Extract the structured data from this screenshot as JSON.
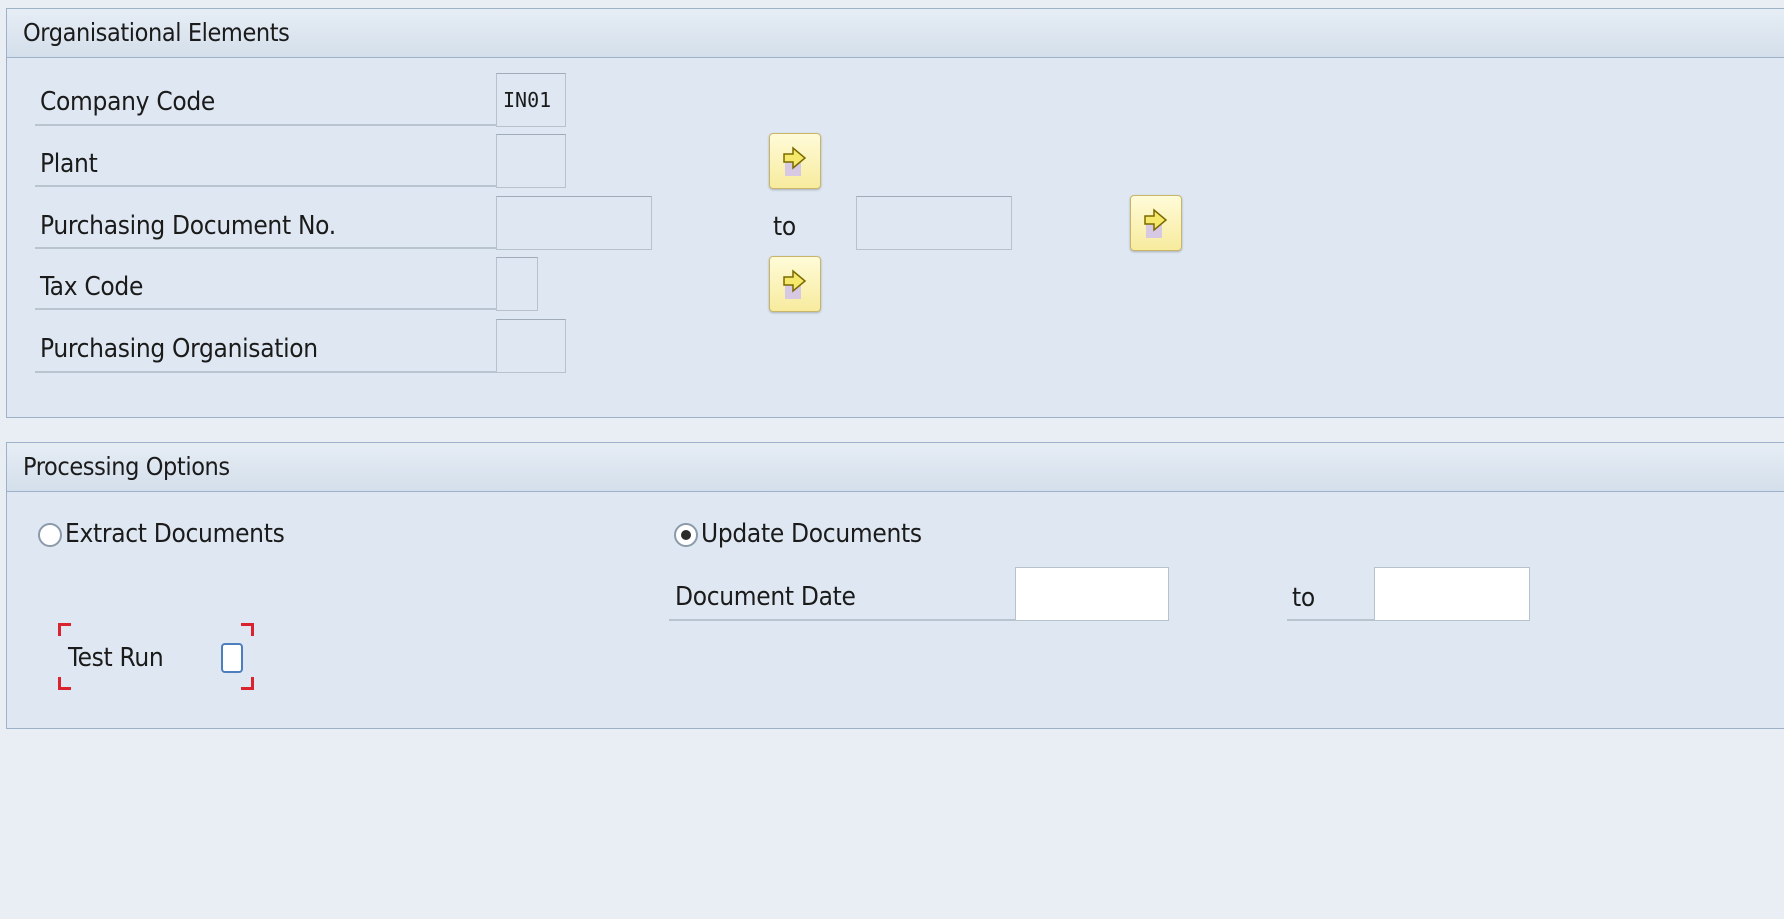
{
  "organisational_elements": {
    "title": "Organisational Elements",
    "company_code": {
      "label": "Company Code",
      "value": "IN01"
    },
    "plant": {
      "label": "Plant",
      "value": ""
    },
    "purchasing_document_no": {
      "label": "Purchasing Document No.",
      "from": "",
      "to_label": "to",
      "to": ""
    },
    "tax_code": {
      "label": "Tax Code",
      "value": ""
    },
    "purchasing_organisation": {
      "label": "Purchasing Organisation",
      "value": ""
    },
    "multiple_selection_icon": "arrow-right-icon"
  },
  "processing_options": {
    "title": "Processing Options",
    "extract_documents": {
      "label": "Extract Documents",
      "selected": false
    },
    "update_documents": {
      "label": "Update Documents",
      "selected": true
    },
    "document_date": {
      "label": "Document Date",
      "from": "",
      "to_label": "to",
      "to": ""
    },
    "test_run": {
      "label": "Test Run",
      "checked": false
    }
  },
  "colors": {
    "background": "#e9eef5",
    "group_background": "#dfe8f2",
    "group_border": "#9db2c8",
    "button_yellow": "#f7eb9e",
    "focus_red": "#d9232e"
  }
}
